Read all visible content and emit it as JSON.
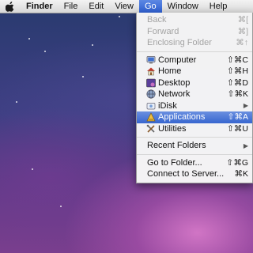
{
  "menubar": {
    "apple_icon": "apple-icon",
    "items": [
      "Finder",
      "File",
      "Edit",
      "View",
      "Go",
      "Window",
      "Help"
    ],
    "active": "Go"
  },
  "go_menu": {
    "back": {
      "label": "Back",
      "shortcut": "⌘["
    },
    "forward": {
      "label": "Forward",
      "shortcut": "⌘]"
    },
    "enclosing": {
      "label": "Enclosing Folder",
      "shortcut": "⌘↑"
    },
    "computer": {
      "label": "Computer",
      "shortcut": "⇧⌘C",
      "icon": "computer-icon"
    },
    "home": {
      "label": "Home",
      "shortcut": "⇧⌘H",
      "icon": "home-icon"
    },
    "desktop": {
      "label": "Desktop",
      "shortcut": "⇧⌘D",
      "icon": "desktop-icon"
    },
    "network": {
      "label": "Network",
      "shortcut": "⇧⌘K",
      "icon": "network-icon"
    },
    "idisk": {
      "label": "iDisk",
      "icon": "idisk-icon",
      "submenu_arrow": "▶"
    },
    "applications": {
      "label": "Applications",
      "shortcut": "⇧⌘A",
      "icon": "applications-icon"
    },
    "utilities": {
      "label": "Utilities",
      "shortcut": "⇧⌘U",
      "icon": "utilities-icon"
    },
    "recent": {
      "label": "Recent Folders",
      "submenu_arrow": "▶"
    },
    "goto": {
      "label": "Go to Folder...",
      "shortcut": "⇧⌘G"
    },
    "connect": {
      "label": "Connect to Server...",
      "shortcut": "⌘K"
    }
  },
  "colors": {
    "highlight": "#3766cf",
    "disabled_text": "#a4a4a4",
    "wallpaper_base": "#3f3f84"
  }
}
